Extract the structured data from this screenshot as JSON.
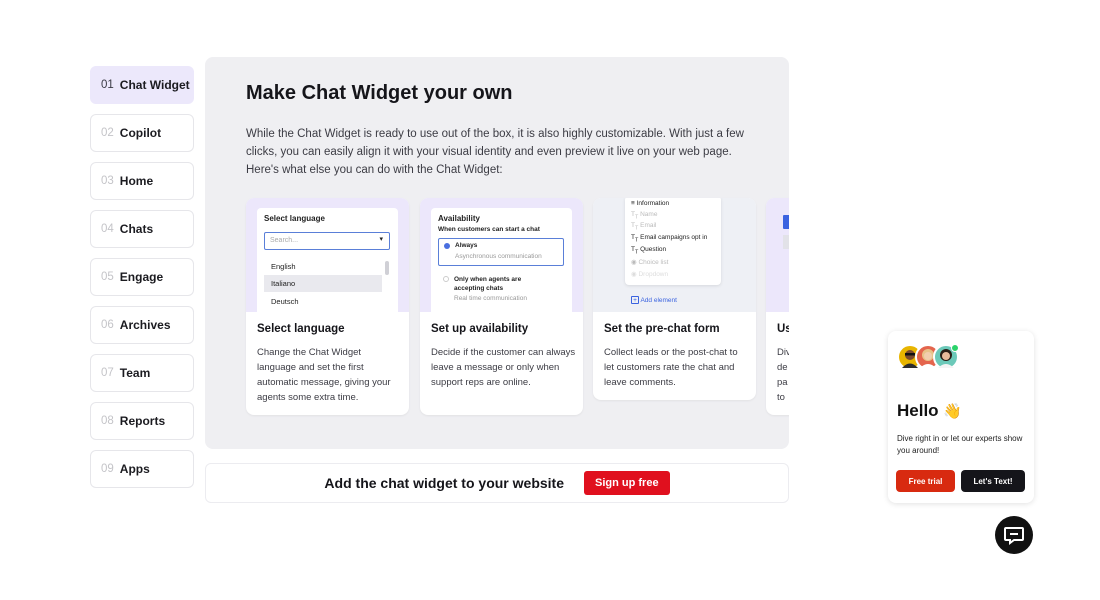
{
  "nav": [
    {
      "num": "01",
      "label": "Chat Widget",
      "active": true
    },
    {
      "num": "02",
      "label": "Copilot"
    },
    {
      "num": "03",
      "label": "Home"
    },
    {
      "num": "04",
      "label": "Chats"
    },
    {
      "num": "05",
      "label": "Engage"
    },
    {
      "num": "06",
      "label": "Archives"
    },
    {
      "num": "07",
      "label": "Team"
    },
    {
      "num": "08",
      "label": "Reports"
    },
    {
      "num": "09",
      "label": "Apps"
    }
  ],
  "main": {
    "title": "Make Chat Widget your own",
    "intro": "While the Chat Widget is ready to use out of the box, it is also highly customizable. With just a few clicks, you can easily align it with your visual identity and even preview it live on your web page. Here's what else you can do with the Chat Widget:"
  },
  "cards": [
    {
      "title": "Select language",
      "desc": "Change the Chat Widget language and set the first automatic message, giving your agents some extra time.",
      "mock": {
        "heading": "Select language",
        "placeholder": "Search...",
        "options": [
          "English",
          "Italiano",
          "Deutsch"
        ],
        "selected": "Italiano"
      }
    },
    {
      "title": "Set up availability",
      "desc": "Decide if the customer can always leave a message or only when support reps are online.",
      "mock": {
        "heading": "Availability",
        "sub": "When customers can start a chat",
        "opt1": "Always",
        "opt1_sub": "Asynchronous communication",
        "opt2": "Only when agents are accepting chats",
        "opt2_sub": "Real time communication"
      }
    },
    {
      "title": "Set the pre-chat form",
      "desc": "Collect leads or the post-chat to let customers rate the chat and leave comments.",
      "mock": {
        "fields": [
          "Information",
          "Name",
          "Email",
          "Email campaigns opt in",
          "Question",
          "Choice list",
          "Dropdown"
        ],
        "add": "Add element"
      }
    },
    {
      "title": "Us",
      "desc": "Div de pa to"
    }
  ],
  "cta": {
    "text": "Add the chat widget to your website",
    "button": "Sign up free"
  },
  "chat": {
    "hello": "Hello",
    "msg": "Dive right in or let our experts show you around!",
    "free_trial": "Free trial",
    "lets_text": "Let's Text!"
  },
  "colors": {
    "accent": "#e0101e",
    "lavender": "#ece7fb",
    "panel": "#efeff2",
    "online": "#2bd36a"
  }
}
